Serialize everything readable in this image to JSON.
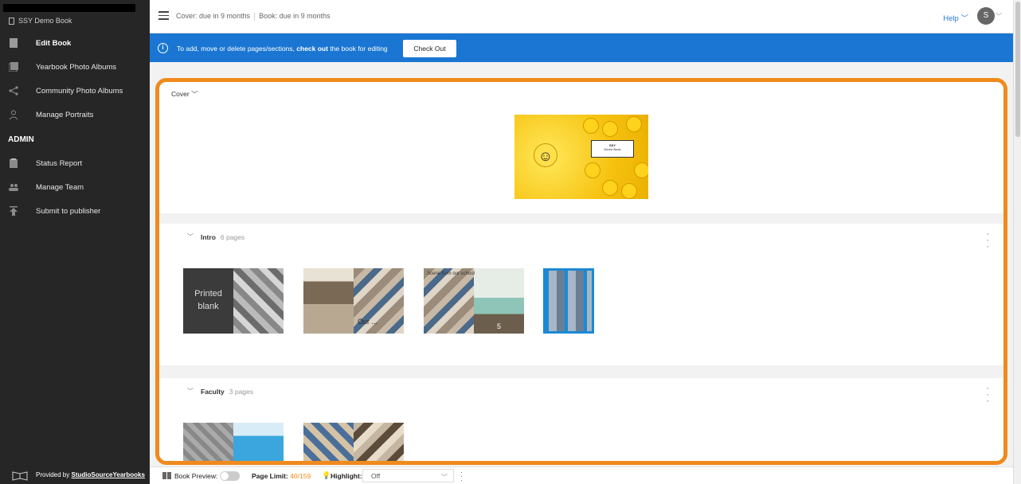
{
  "sidebar": {
    "book_name": "SSY Demo Book",
    "items": [
      {
        "label": "Edit Book",
        "icon": "book-icon"
      },
      {
        "label": "Yearbook Photo Albums",
        "icon": "photo-album-icon"
      },
      {
        "label": "Community Photo Albums",
        "icon": "share-icon"
      },
      {
        "label": "Manage Portraits",
        "icon": "person-icon"
      }
    ],
    "admin_heading": "ADMIN",
    "admin_items": [
      {
        "label": "Status Report",
        "icon": "clipboard-icon"
      },
      {
        "label": "Manage Team",
        "icon": "team-icon"
      },
      {
        "label": "Submit to publisher",
        "icon": "upload-icon"
      }
    ],
    "footer": {
      "prefix": "Provided by",
      "link": "StudioSourceYearbooks"
    }
  },
  "header": {
    "cover_due": "Cover: due in 9 months",
    "book_due": "Book: due in 9 months",
    "help_label": "Help",
    "avatar_initial": "S"
  },
  "banner": {
    "msg_part1": "To add, move or delete pages/sections,",
    "msg_bold": "check out",
    "msg_part2": "the book for editing",
    "button": "Check Out",
    "color": "#1a76d2"
  },
  "cover": {
    "title": "Cover",
    "label_line1": "SSY",
    "label_line2": "Demo Book"
  },
  "sections": [
    {
      "name": "Intro",
      "count": "6 pages",
      "thumbs": [
        {
          "left_text": "Printed blank"
        },
        {
          "caption": "Our ..."
        },
        {
          "caption": "Scene from our school",
          "page": "5"
        },
        {}
      ]
    },
    {
      "name": "Faculty",
      "count": "3 pages",
      "thumbs": [
        {},
        {}
      ]
    }
  ],
  "bottombar": {
    "preview_label": "Book Preview:",
    "page_limit_label": "Page Limit:",
    "page_limit_value": "40/159",
    "highlight_label": "Highlight:",
    "highlight_value": "Off"
  },
  "colors": {
    "frame": "#f08a1c",
    "accent": "#2b7bd5"
  }
}
